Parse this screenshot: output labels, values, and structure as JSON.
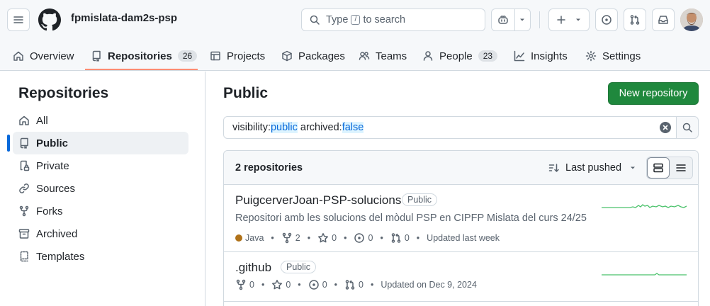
{
  "header": {
    "org_name": "fpmislata-dam2s-psp",
    "search": {
      "prefix": "Type",
      "key": "/",
      "suffix": "to search"
    }
  },
  "tabs": [
    {
      "label": "Overview",
      "icon": "home-icon"
    },
    {
      "label": "Repositories",
      "count": "26",
      "icon": "repo-icon",
      "active": true
    },
    {
      "label": "Projects",
      "icon": "table-icon"
    },
    {
      "label": "Packages",
      "icon": "package-icon"
    },
    {
      "label": "Teams",
      "icon": "people-icon"
    },
    {
      "label": "People",
      "count": "23",
      "icon": "person-icon"
    },
    {
      "label": "Insights",
      "icon": "graph-icon"
    },
    {
      "label": "Settings",
      "icon": "gear-icon"
    }
  ],
  "sidebar": {
    "title": "Repositories",
    "items": [
      {
        "label": "All",
        "icon": "home-icon"
      },
      {
        "label": "Public",
        "icon": "repo-icon",
        "active": true
      },
      {
        "label": "Private",
        "icon": "lock-icon"
      },
      {
        "label": "Sources",
        "icon": "link-icon"
      },
      {
        "label": "Forks",
        "icon": "fork-icon"
      },
      {
        "label": "Archived",
        "icon": "archive-icon"
      },
      {
        "label": "Templates",
        "icon": "template-icon"
      }
    ]
  },
  "main": {
    "title": "Public",
    "new_repo_label": "New repository",
    "filter": {
      "key1": "visibility:",
      "val1": "public",
      "key2": "archived:",
      "val2": "false"
    },
    "repo_count": "2 repositories",
    "sort_label": "Last pushed",
    "repos": [
      {
        "name": "PuigcerverJoan-PSP-solucions",
        "visibility": "Public",
        "description": "Repositori amb les solucions del mòdul PSP en CIPFP Mislata del curs 24/25",
        "language": "Java",
        "language_color": "#b07219",
        "forks": "2",
        "stars": "0",
        "issues": "0",
        "pulls": "0",
        "updated": "Updated last week"
      },
      {
        "name": ".github",
        "visibility": "Public",
        "forks": "0",
        "stars": "0",
        "issues": "0",
        "pulls": "0",
        "updated": "Updated on Dec 9, 2024"
      }
    ]
  },
  "colors": {
    "accent": "#0969da",
    "primary_button": "#1f883d",
    "tab_underline": "#fd8c73",
    "spark": "#4ac26b"
  }
}
